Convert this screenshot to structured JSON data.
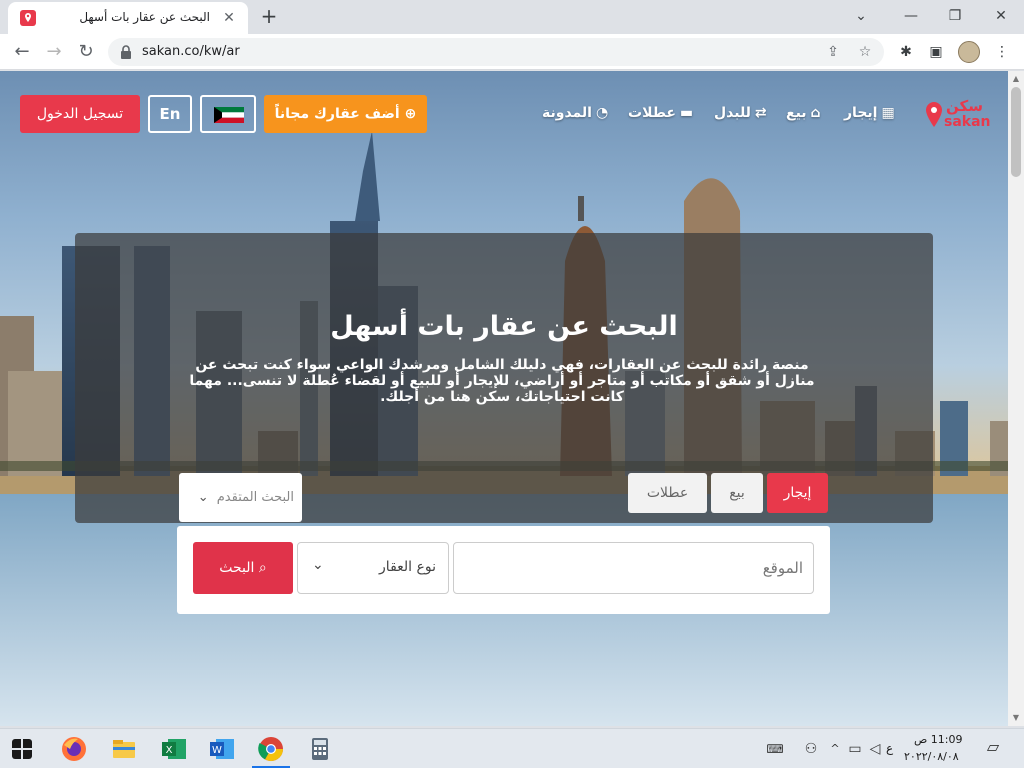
{
  "browser": {
    "tab_title": "البحث عن عقار بات أسهل",
    "tab_close": "✕",
    "new_tab": "+",
    "url": "sakan.co/kw/ar",
    "win_min": "⌄",
    "win_restore": "❐",
    "win_close": "✕",
    "back": "←",
    "forward": "→",
    "reload": "↻",
    "share_icon": "⇪",
    "star_icon": "☆",
    "extensions_icon": "✱",
    "sidepanel_icon": "▣",
    "menu_icon": "⋮"
  },
  "site": {
    "logo_ar": "سكن",
    "logo_en": "sakan",
    "nav": [
      {
        "label": "إيجار",
        "icon": "building-icon",
        "glyph": "▦"
      },
      {
        "label": "بيع",
        "icon": "home-icon",
        "glyph": "⌂"
      },
      {
        "label": "للبدل",
        "icon": "exchange-icon",
        "glyph": "⇄"
      },
      {
        "label": "عطلات",
        "icon": "bed-icon",
        "glyph": "▬"
      },
      {
        "label": "المدونة",
        "icon": "rss-icon",
        "glyph": "◔"
      }
    ],
    "add_property": "أضف عقارك مجاناً",
    "add_icon": "⊕",
    "lang": "En",
    "login": "تسجيل الدخول"
  },
  "hero": {
    "title": "البحث عن عقار بات أسهل",
    "description": "منصة رائدة للبحث عن العقارات، فهي دليلك الشامل ومرشدك الواعي سواء كنت تبحث عن منازل أو شقق أو مكاتب أو متاجر أو أراضي، للإيجار أو للبيع أو لقضاء عُطلة لا تنسى... مهما كانت احتياجاتك، سكن هنا من أجلك."
  },
  "search": {
    "tabs": [
      "إيجار",
      "بيع",
      "عطلات"
    ],
    "advanced": "البحث المتقدم",
    "location_placeholder": "الموقع",
    "property_type": "نوع العقار",
    "button": "البحث",
    "search_icon": "⌕",
    "chevron": "⌄"
  },
  "taskbar": {
    "time": "11:09 ص",
    "date": "٢٠٢٢/٠٨/٠٨",
    "lang_indicator": "ع",
    "apps": [
      "start",
      "firefox",
      "file-explorer",
      "excel",
      "word",
      "chrome",
      "calculator"
    ]
  },
  "colors": {
    "brand_red": "#e8394b",
    "add_orange": "#f7941d"
  }
}
